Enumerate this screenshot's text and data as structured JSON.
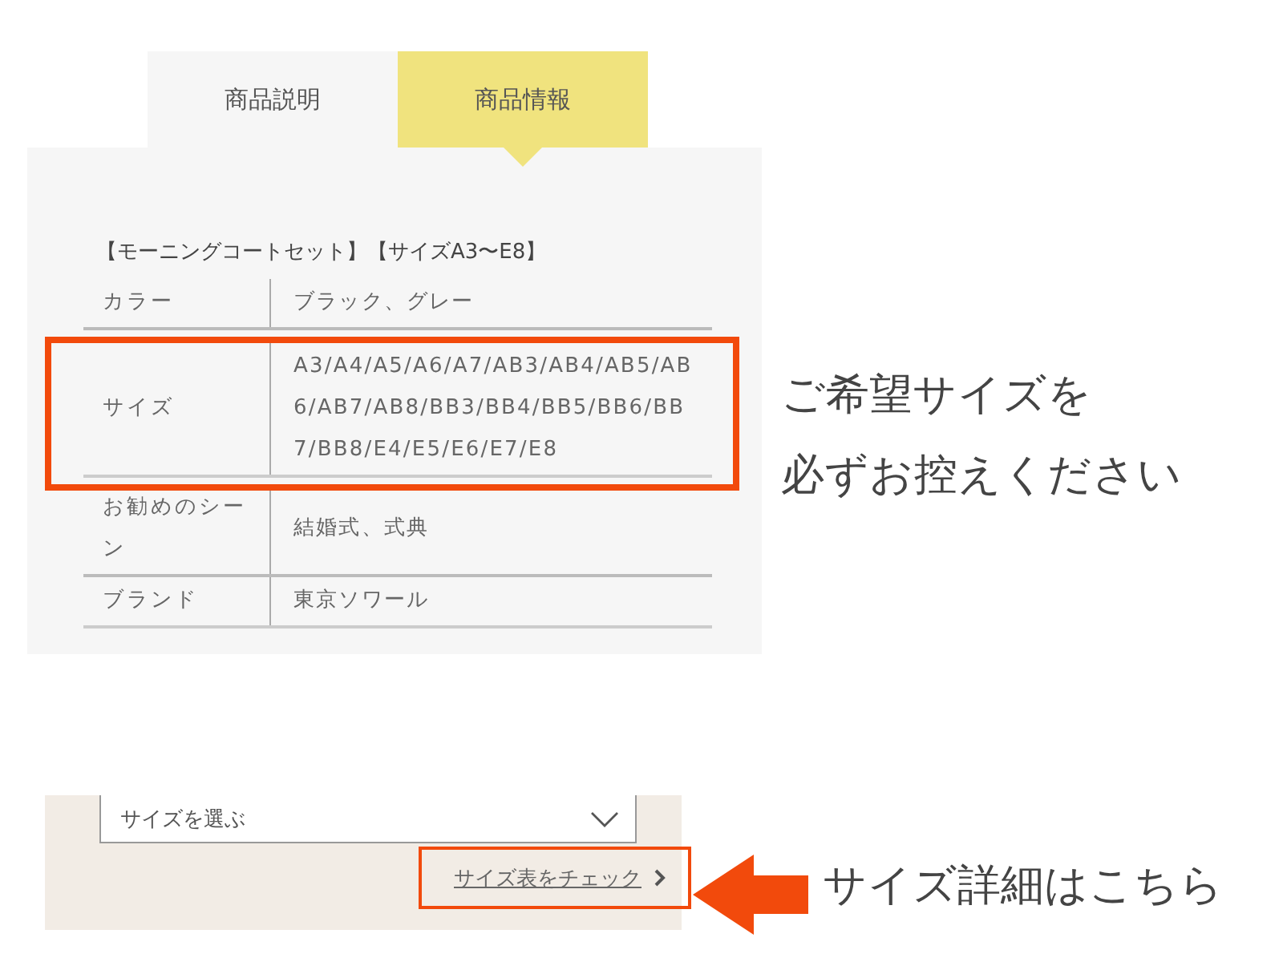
{
  "tabs": [
    {
      "label": "商品説明",
      "selected": false
    },
    {
      "label": "商品情報",
      "selected": true
    }
  ],
  "spec_heading": "【モーニングコートセット】【サイズA3〜E8】",
  "spec_rows": [
    {
      "label": "カラー",
      "value": "ブラック、グレー",
      "highlighted": false
    },
    {
      "label": "サイズ",
      "value": "A3/A4/A5/A6/A7/AB3/AB4/AB5/AB6/AB7/AB8/BB3/BB4/BB5/BB6/BB7/BB8/E4/E5/E6/E7/E8",
      "highlighted": true
    },
    {
      "label": "お勧めのシーン",
      "value": "結婚式、式典",
      "highlighted": false
    },
    {
      "label": "ブランド",
      "value": "東京ソワール",
      "highlighted": false
    }
  ],
  "size_note": [
    "ご希望サイズを",
    "必ずお控えください"
  ],
  "size_select": {
    "placeholder": "サイズを選ぶ"
  },
  "size_chart_link": {
    "label": "サイズ表をチェック",
    "highlighted": true
  },
  "link_note": "サイズ詳細はこちら"
}
